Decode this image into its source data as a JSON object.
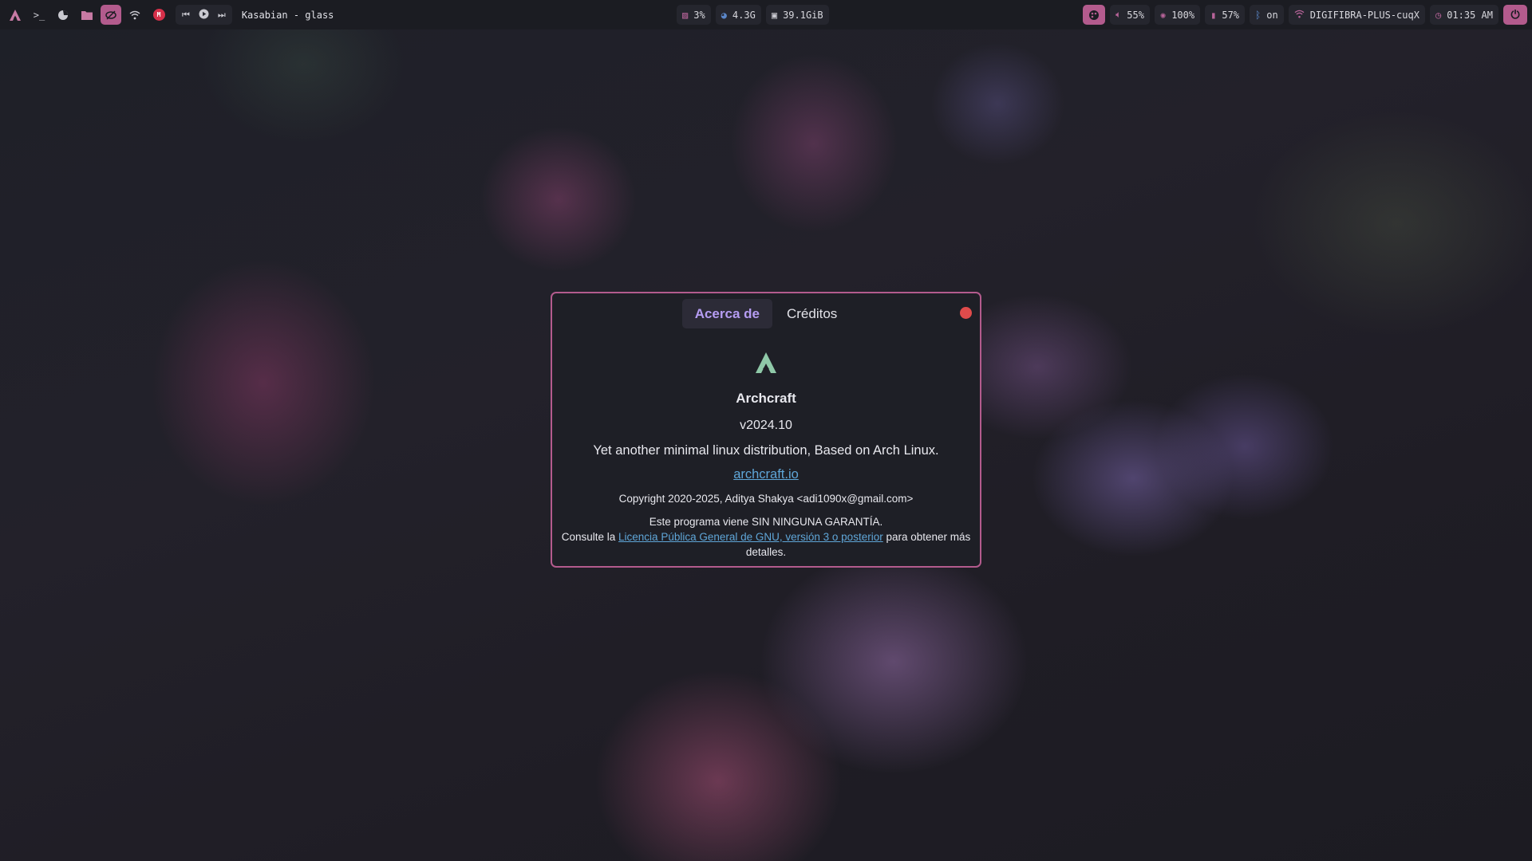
{
  "topbar": {
    "left_icons": [
      "archcraft-logo-icon",
      "terminal-icon",
      "firefox-icon",
      "folder-icon",
      "eye-off-icon",
      "wifi-icon",
      "gmail-icon"
    ],
    "gmail_label": "M",
    "media": {
      "prev_icon": "⏮",
      "play_icon": "▶",
      "next_icon": "⏭",
      "track": "Kasabian - glass"
    },
    "center": {
      "cpu": "3%",
      "memory": "4.3G",
      "disk": "39.1GiB"
    },
    "right": {
      "volume": "55%",
      "brightness": "100%",
      "battery": "57%",
      "bluetooth": "on",
      "network": "DIGIFIBRA-PLUS-cuqX",
      "clock": "01:35 AM"
    },
    "accent_color": "#b35b8d"
  },
  "dialog": {
    "tabs": [
      {
        "label": "Acerca de",
        "active": true
      },
      {
        "label": "Créditos",
        "active": false
      }
    ],
    "app_name": "Archcraft",
    "version": "v2024.10",
    "comments": "Yet another minimal linux distribution, Based on Arch Linux.",
    "website": "archcraft.io",
    "copyright": "Copyright 2020-2025, Aditya Shakya <adi1090x@gmail.com>",
    "license_line1": "Este programa viene SIN NINGUNA GARANTÍA.",
    "license_pre": "Consulte la ",
    "license_link": "Licencia Pública General de GNU, versión 3 o posterior",
    "license_post": " para obtener más detalles.",
    "border_color": "#b35b8d",
    "link_color": "#5fa6d8"
  }
}
